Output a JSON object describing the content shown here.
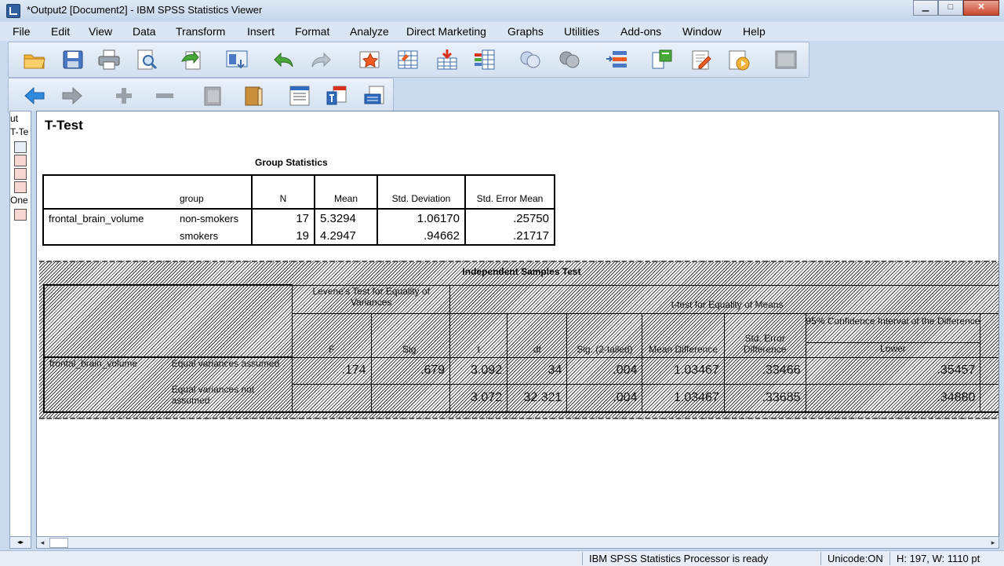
{
  "window": {
    "title": "*Output2 [Document2] - IBM SPSS Statistics Viewer",
    "minimize": "▁",
    "maximize": "□",
    "close": "✕"
  },
  "menu": [
    "File",
    "Edit",
    "View",
    "Data",
    "Transform",
    "Insert",
    "Format",
    "Analyze",
    "Direct Marketing",
    "Graphs",
    "Utilities",
    "Add-ons",
    "Window",
    "Help"
  ],
  "outline": {
    "item1": "ut",
    "item2": "T-Te",
    "item3": "One"
  },
  "output": {
    "heading": "T-Test",
    "group_statistics": {
      "title": "Group Statistics",
      "headers": {
        "group": "group",
        "n": "N",
        "mean": "Mean",
        "sd": "Std. Deviation",
        "se": "Std. Error Mean"
      },
      "variable": "frontal_brain_volume",
      "rows": [
        {
          "group": "non-smokers",
          "n": "17",
          "mean": "5.3294",
          "sd": "1.06170",
          "se": ".25750"
        },
        {
          "group": "smokers",
          "n": "19",
          "mean": "4.2947",
          "sd": ".94662",
          "se": ".21717"
        }
      ]
    },
    "independent_samples": {
      "title": "Independent Samples Test",
      "levene_header": "Levene's Test for Equality of Variances",
      "ttest_header": "t-test for Equality of Means",
      "ci_header": "95% Confidence Interval of the Difference",
      "cols": {
        "f": "F",
        "sig": "Sig.",
        "t": "t",
        "df": "df",
        "sig2": "Sig. (2-tailed)",
        "md": "Mean Difference",
        "sed": "Std. Error Difference",
        "lower": "Lower"
      },
      "variable": "frontal_brain_volume",
      "rows": [
        {
          "label": "Equal variances assumed",
          "f": ".174",
          "sig": ".679",
          "t": "3.092",
          "df": "34",
          "sig2": ".004",
          "md": "1.03467",
          "sed": ".33466",
          "lower": ".35457"
        },
        {
          "label": "Equal variances not assumed",
          "f": "",
          "sig": "",
          "t": "3.072",
          "df": "32.321",
          "sig2": ".004",
          "md": "1.03467",
          "sed": ".33685",
          "lower": ".34880"
        }
      ]
    }
  },
  "status": {
    "processor": "IBM SPSS Statistics Processor is ready",
    "unicode": "Unicode:ON",
    "size": "H: 197, W: 1110 pt"
  }
}
